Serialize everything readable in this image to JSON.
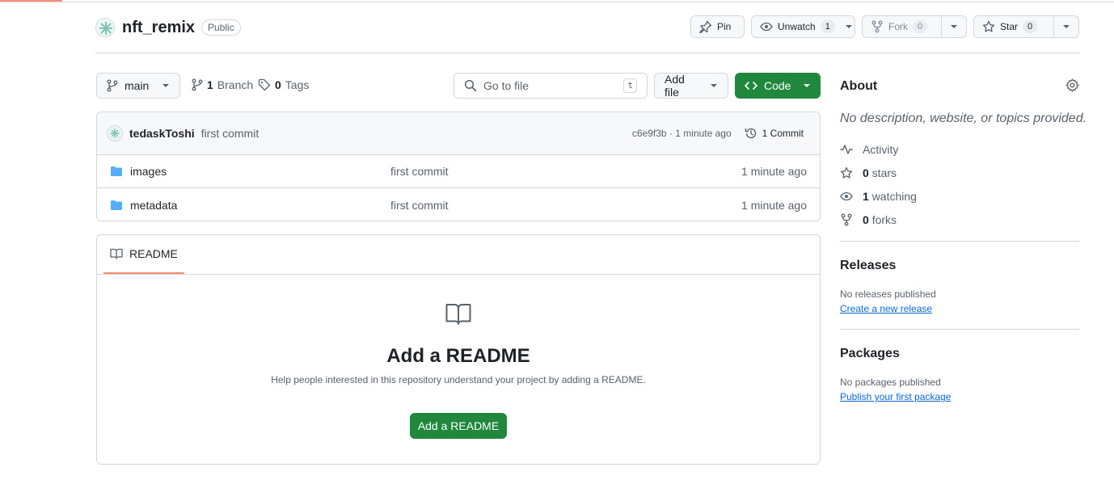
{
  "repo": {
    "name": "nft_remix",
    "visibility": "Public"
  },
  "header_actions": {
    "pin_label": "Pin",
    "unwatch_label": "Unwatch",
    "watch_count": "1",
    "fork_label": "Fork",
    "fork_count": "0",
    "star_label": "Star",
    "star_count": "0"
  },
  "toolbar": {
    "branch": "main",
    "branches_count": "1",
    "branches_label": "Branch",
    "tags_count": "0",
    "tags_label": "Tags",
    "goto_placeholder": "Go to file",
    "goto_shortcut": "t",
    "add_file_label": "Add file",
    "code_label": "Code"
  },
  "latest_commit": {
    "author": "tedaskToshi",
    "message": "first commit",
    "sha_time": "c6e9f3b · 1 minute ago",
    "commits_label": "1 Commit"
  },
  "files": [
    {
      "name": "images",
      "message": "first commit",
      "age": "1 minute ago"
    },
    {
      "name": "metadata",
      "message": "first commit",
      "age": "1 minute ago"
    }
  ],
  "readme": {
    "tab_label": "README",
    "title": "Add a README",
    "description": "Help people interested in this repository understand your project by adding a README.",
    "button_label": "Add a README"
  },
  "about": {
    "title": "About",
    "description": "No description, website, or topics provided.",
    "activity_label": "Activity",
    "stars_count": "0",
    "stars_label": "stars",
    "watching_count": "1",
    "watching_label": "watching",
    "forks_count": "0",
    "forks_label": "forks"
  },
  "releases": {
    "title": "Releases",
    "empty": "No releases published",
    "link": "Create a new release"
  },
  "packages": {
    "title": "Packages",
    "empty": "No packages published",
    "link": "Publish your first package"
  },
  "colors": {
    "accent_green": "#1f883d",
    "link_blue": "#0969da",
    "folder_blue": "#54aeff",
    "tab_underline": "#fd8c73"
  }
}
